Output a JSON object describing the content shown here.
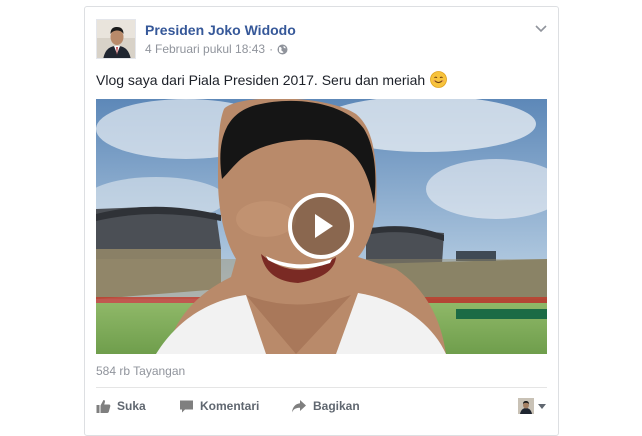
{
  "post": {
    "author": "Presiden Joko Widodo",
    "timestamp": "4 Februari pukul 18:43",
    "separator": "·",
    "text": "Vlog saya dari Piala Presiden 2017. Seru dan meriah",
    "emoji_icon": "smiling-face-emoji"
  },
  "video": {
    "views": "584 rb Tayangan",
    "play_icon": "play-icon"
  },
  "actions": {
    "like_label": "Suka",
    "comment_label": "Komentari",
    "share_label": "Bagikan"
  },
  "colors": {
    "author_link": "#365899",
    "meta_text": "#90949c",
    "action_text": "#606770",
    "border": "#dddfe2"
  }
}
